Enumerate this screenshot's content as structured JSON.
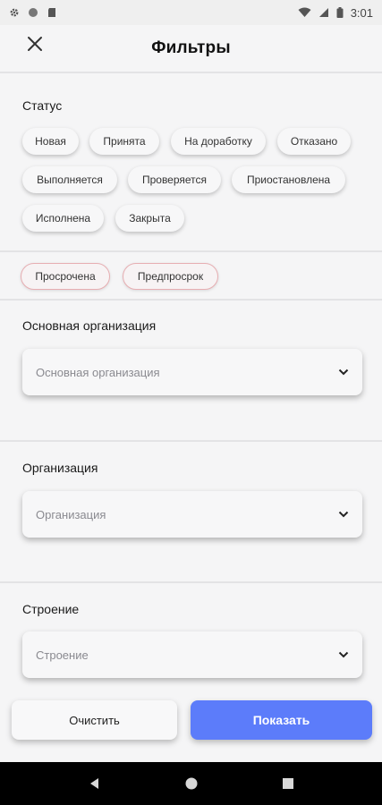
{
  "status_bar": {
    "time": "3:01",
    "icons": [
      "settings-icon",
      "circle-icon",
      "sd-card-icon",
      "wifi-icon",
      "signal-icon",
      "battery-icon"
    ]
  },
  "header": {
    "title": "Фильтры",
    "close_icon": "close-icon"
  },
  "status_section": {
    "title": "Статус",
    "chips": [
      "Новая",
      "Принята",
      "На доработку",
      "Отказано",
      "Выполняется",
      "Проверяется",
      "Приостановлена",
      "Исполнена",
      "Закрыта"
    ],
    "overdue_chips": [
      "Просрочена",
      "Предпросрок"
    ]
  },
  "main_org": {
    "title": "Основная организация",
    "placeholder": "Основная организация"
  },
  "org": {
    "title": "Организация",
    "placeholder": "Организация"
  },
  "building": {
    "title": "Строение",
    "placeholder": "Строение"
  },
  "actions": {
    "clear_label": "Очистить",
    "show_label": "Показать"
  },
  "colors": {
    "accent": "#5c7cfa",
    "overdue_border": "#e7aeb2",
    "background": "#f5f5f6",
    "nav_bar": "#000000"
  }
}
